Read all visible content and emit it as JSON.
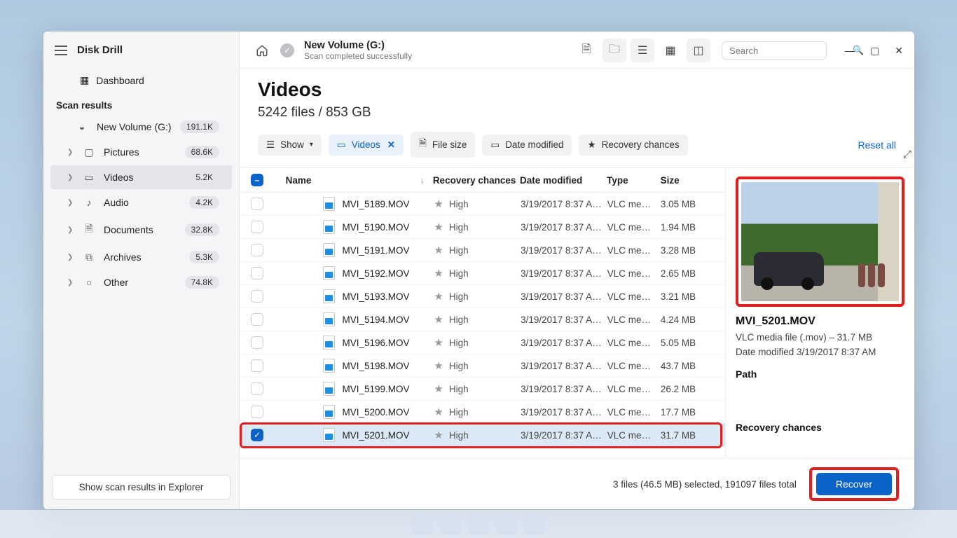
{
  "app_title": "Disk Drill",
  "sidebar": {
    "dashboard": "Dashboard",
    "scan_results_heading": "Scan results",
    "volume": {
      "label": "New Volume (G:)",
      "badge": "191.1K"
    },
    "categories": [
      {
        "label": "Pictures",
        "badge": "68.6K"
      },
      {
        "label": "Videos",
        "badge": "5.2K"
      },
      {
        "label": "Audio",
        "badge": "4.2K"
      },
      {
        "label": "Documents",
        "badge": "32.8K"
      },
      {
        "label": "Archives",
        "badge": "5.3K"
      },
      {
        "label": "Other",
        "badge": "74.8K"
      }
    ],
    "explorer_button": "Show scan results in Explorer"
  },
  "topbar": {
    "title": "New Volume (G:)",
    "subtitle": "Scan completed successfully",
    "search_placeholder": "Search"
  },
  "header": {
    "title": "Videos",
    "count": "5242 files / 853 GB"
  },
  "filters": {
    "show": "Show",
    "videos": "Videos",
    "file_size": "File size",
    "date_modified": "Date modified",
    "recovery": "Recovery chances",
    "reset": "Reset all"
  },
  "columns": {
    "name": "Name",
    "recovery": "Recovery chances",
    "date": "Date modified",
    "type": "Type",
    "size": "Size"
  },
  "rows": [
    {
      "checked": false,
      "name": "MVI_5189.MOV",
      "rec": "High",
      "date": "3/19/2017 8:37 A…",
      "type": "VLC me…",
      "size": "3.05 MB"
    },
    {
      "checked": false,
      "name": "MVI_5190.MOV",
      "rec": "High",
      "date": "3/19/2017 8:37 A…",
      "type": "VLC me…",
      "size": "1.94 MB"
    },
    {
      "checked": false,
      "name": "MVI_5191.MOV",
      "rec": "High",
      "date": "3/19/2017 8:37 A…",
      "type": "VLC me…",
      "size": "3.28 MB"
    },
    {
      "checked": false,
      "name": "MVI_5192.MOV",
      "rec": "High",
      "date": "3/19/2017 8:37 A…",
      "type": "VLC me…",
      "size": "2.65 MB"
    },
    {
      "checked": false,
      "name": "MVI_5193.MOV",
      "rec": "High",
      "date": "3/19/2017 8:37 A…",
      "type": "VLC me…",
      "size": "3.21 MB"
    },
    {
      "checked": false,
      "name": "MVI_5194.MOV",
      "rec": "High",
      "date": "3/19/2017 8:37 A…",
      "type": "VLC me…",
      "size": "4.24 MB"
    },
    {
      "checked": false,
      "name": "MVI_5196.MOV",
      "rec": "High",
      "date": "3/19/2017 8:37 A…",
      "type": "VLC me…",
      "size": "5.05 MB"
    },
    {
      "checked": false,
      "name": "MVI_5198.MOV",
      "rec": "High",
      "date": "3/19/2017 8:37 A…",
      "type": "VLC me…",
      "size": "43.7 MB"
    },
    {
      "checked": false,
      "name": "MVI_5199.MOV",
      "rec": "High",
      "date": "3/19/2017 8:37 A…",
      "type": "VLC me…",
      "size": "26.2 MB"
    },
    {
      "checked": false,
      "name": "MVI_5200.MOV",
      "rec": "High",
      "date": "3/19/2017 8:37 A…",
      "type": "VLC me…",
      "size": "17.7 MB"
    },
    {
      "checked": true,
      "name": "MVI_5201.MOV",
      "rec": "High",
      "date": "3/19/2017 8:37 A…",
      "type": "VLC me…",
      "size": "31.7 MB"
    }
  ],
  "details": {
    "name": "MVI_5201.MOV",
    "meta": "VLC media file (.mov) – 31.7 MB",
    "modified": "Date modified 3/19/2017 8:37 AM",
    "path_label": "Path",
    "recovery_label": "Recovery chances"
  },
  "footer": {
    "status": "3 files (46.5 MB) selected, 191097 files total",
    "recover": "Recover"
  }
}
